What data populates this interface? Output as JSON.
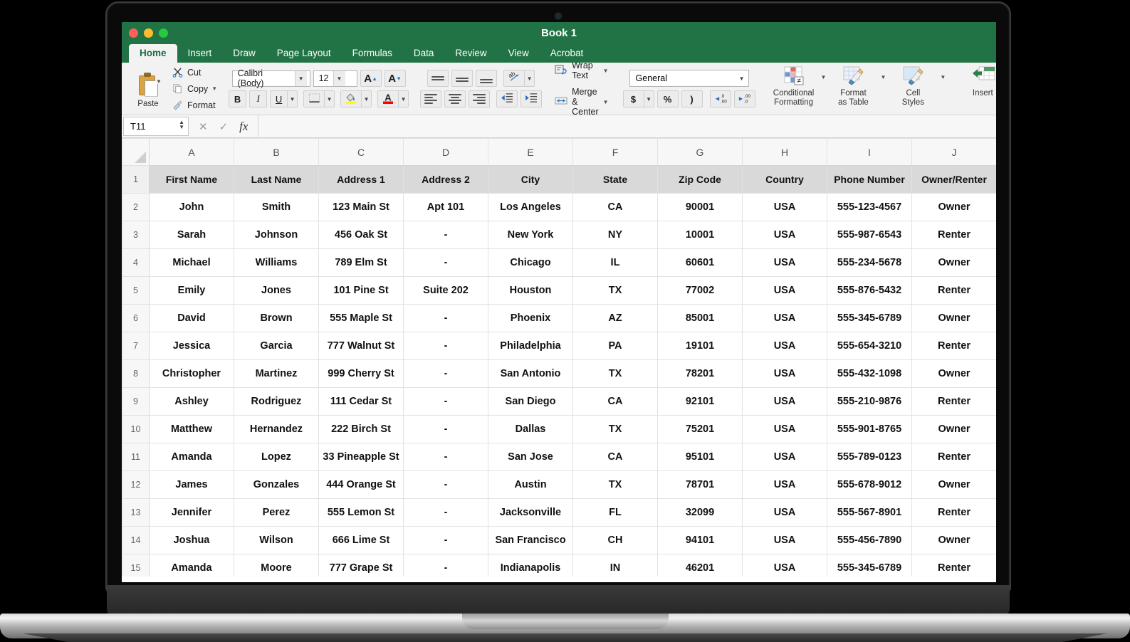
{
  "window": {
    "title": "Book 1",
    "traffic_lights": [
      "close-red",
      "minimize-amber",
      "zoom-green"
    ]
  },
  "ribbon": {
    "tabs": [
      {
        "label": "Home",
        "active": true
      },
      {
        "label": "Insert",
        "active": false
      },
      {
        "label": "Draw",
        "active": false
      },
      {
        "label": "Page Layout",
        "active": false
      },
      {
        "label": "Formulas",
        "active": false
      },
      {
        "label": "Data",
        "active": false
      },
      {
        "label": "Review",
        "active": false
      },
      {
        "label": "View",
        "active": false
      },
      {
        "label": "Acrobat",
        "active": false
      }
    ],
    "clipboard": {
      "paste": "Paste",
      "cut": "Cut",
      "copy": "Copy",
      "format": "Format"
    },
    "font": {
      "family": "Calibri (Body)",
      "size": "12",
      "grow": "A",
      "shrink": "A",
      "bold": "B",
      "italic": "I",
      "underline": "U"
    },
    "alignment": {
      "orientation_icon": "ab",
      "wrap_text": "Wrap Text",
      "merge_center": "Merge & Center"
    },
    "number": {
      "format": "General",
      "currency": "$",
      "percent": "%",
      "comma": ")",
      "increase_decimal": ".00",
      "decrease_decimal": ".00"
    },
    "styles": [
      {
        "label_line1": "Conditional",
        "label_line2": "Formatting"
      },
      {
        "label_line1": "Format",
        "label_line2": "as Table"
      },
      {
        "label_line1": "Cell",
        "label_line2": "Styles"
      }
    ],
    "cells": {
      "insert": "Insert"
    }
  },
  "formula_bar": {
    "name_box": "T11",
    "cancel_icon": "✕",
    "confirm_icon": "✓",
    "function_icon": "fx",
    "formula_value": ""
  },
  "sheet": {
    "columns": [
      "A",
      "B",
      "C",
      "D",
      "E",
      "F",
      "G",
      "H",
      "I",
      "J"
    ],
    "header_row_number": "1",
    "headers": [
      "First Name",
      "Last Name",
      "Address 1",
      "Address 2",
      "City",
      "State",
      "Zip Code",
      "Country",
      "Phone Number",
      "Owner/Renter"
    ],
    "rows": [
      {
        "n": "2",
        "cells": [
          "John",
          "Smith",
          "123 Main St",
          "Apt 101",
          "Los Angeles",
          "CA",
          "90001",
          "USA",
          "555-123-4567",
          "Owner"
        ]
      },
      {
        "n": "3",
        "cells": [
          "Sarah",
          "Johnson",
          "456 Oak St",
          "-",
          "New York",
          "NY",
          "10001",
          "USA",
          "555-987-6543",
          "Renter"
        ]
      },
      {
        "n": "4",
        "cells": [
          "Michael",
          "Williams",
          "789 Elm St",
          "-",
          "Chicago",
          "IL",
          "60601",
          "USA",
          "555-234-5678",
          "Owner"
        ]
      },
      {
        "n": "5",
        "cells": [
          "Emily",
          "Jones",
          "101 Pine St",
          "Suite 202",
          "Houston",
          "TX",
          "77002",
          "USA",
          "555-876-5432",
          "Renter"
        ]
      },
      {
        "n": "6",
        "cells": [
          "David",
          "Brown",
          "555 Maple St",
          "-",
          "Phoenix",
          "AZ",
          "85001",
          "USA",
          "555-345-6789",
          "Owner"
        ]
      },
      {
        "n": "7",
        "cells": [
          "Jessica",
          "Garcia",
          "777 Walnut St",
          "-",
          "Philadelphia",
          "PA",
          "19101",
          "USA",
          "555-654-3210",
          "Renter"
        ]
      },
      {
        "n": "8",
        "cells": [
          "Christopher",
          "Martinez",
          "999 Cherry St",
          "-",
          "San Antonio",
          "TX",
          "78201",
          "USA",
          "555-432-1098",
          "Owner"
        ]
      },
      {
        "n": "9",
        "cells": [
          "Ashley",
          "Rodriguez",
          "111 Cedar St",
          "-",
          "San Diego",
          "CA",
          "92101",
          "USA",
          "555-210-9876",
          "Renter"
        ]
      },
      {
        "n": "10",
        "cells": [
          "Matthew",
          "Hernandez",
          "222 Birch St",
          "-",
          "Dallas",
          "TX",
          "75201",
          "USA",
          "555-901-8765",
          "Owner"
        ]
      },
      {
        "n": "11",
        "cells": [
          "Amanda",
          "Lopez",
          "33 Pineapple St",
          "-",
          "San Jose",
          "CA",
          "95101",
          "USA",
          "555-789-0123",
          "Renter"
        ]
      },
      {
        "n": "12",
        "cells": [
          "James",
          "Gonzales",
          "444 Orange St",
          "-",
          "Austin",
          "TX",
          "78701",
          "USA",
          "555-678-9012",
          "Owner"
        ]
      },
      {
        "n": "13",
        "cells": [
          "Jennifer",
          "Perez",
          "555 Lemon St",
          "-",
          "Jacksonville",
          "FL",
          "32099",
          "USA",
          "555-567-8901",
          "Renter"
        ]
      },
      {
        "n": "14",
        "cells": [
          "Joshua",
          "Wilson",
          "666 Lime St",
          "-",
          "San Francisco",
          "CH",
          "94101",
          "USA",
          "555-456-7890",
          "Owner"
        ]
      },
      {
        "n": "15",
        "cells": [
          "Amanda",
          "Moore",
          "777 Grape St",
          "-",
          "Indianapolis",
          "IN",
          "46201",
          "USA",
          "555-345-6789",
          "Renter"
        ]
      }
    ]
  },
  "colors": {
    "excel_green": "#217346",
    "ribbon_bg": "#f2f2f2",
    "header_fill": "#d9d9d9",
    "fill_highlight": "#ffff00",
    "font_color_red": "#ff0000"
  }
}
